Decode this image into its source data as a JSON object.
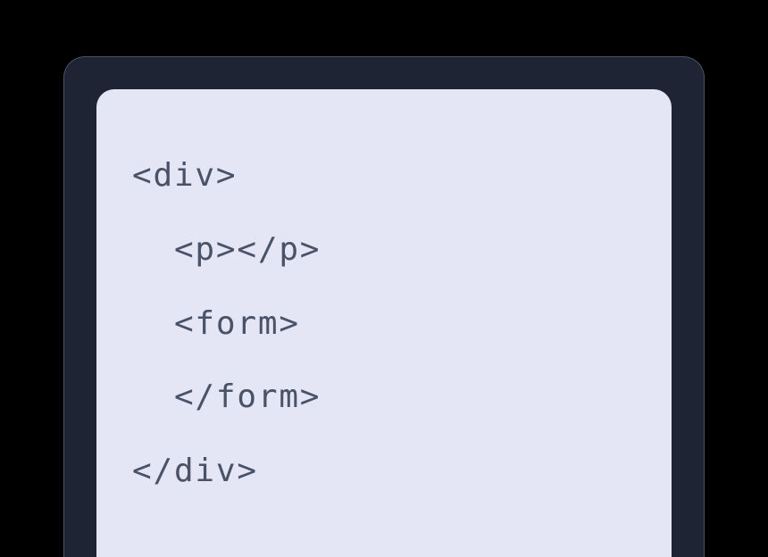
{
  "code": {
    "line1": "<div>",
    "line2": "  <p></p>",
    "line3": "  <form>",
    "line4": "  </form>",
    "line5": "</div>"
  }
}
